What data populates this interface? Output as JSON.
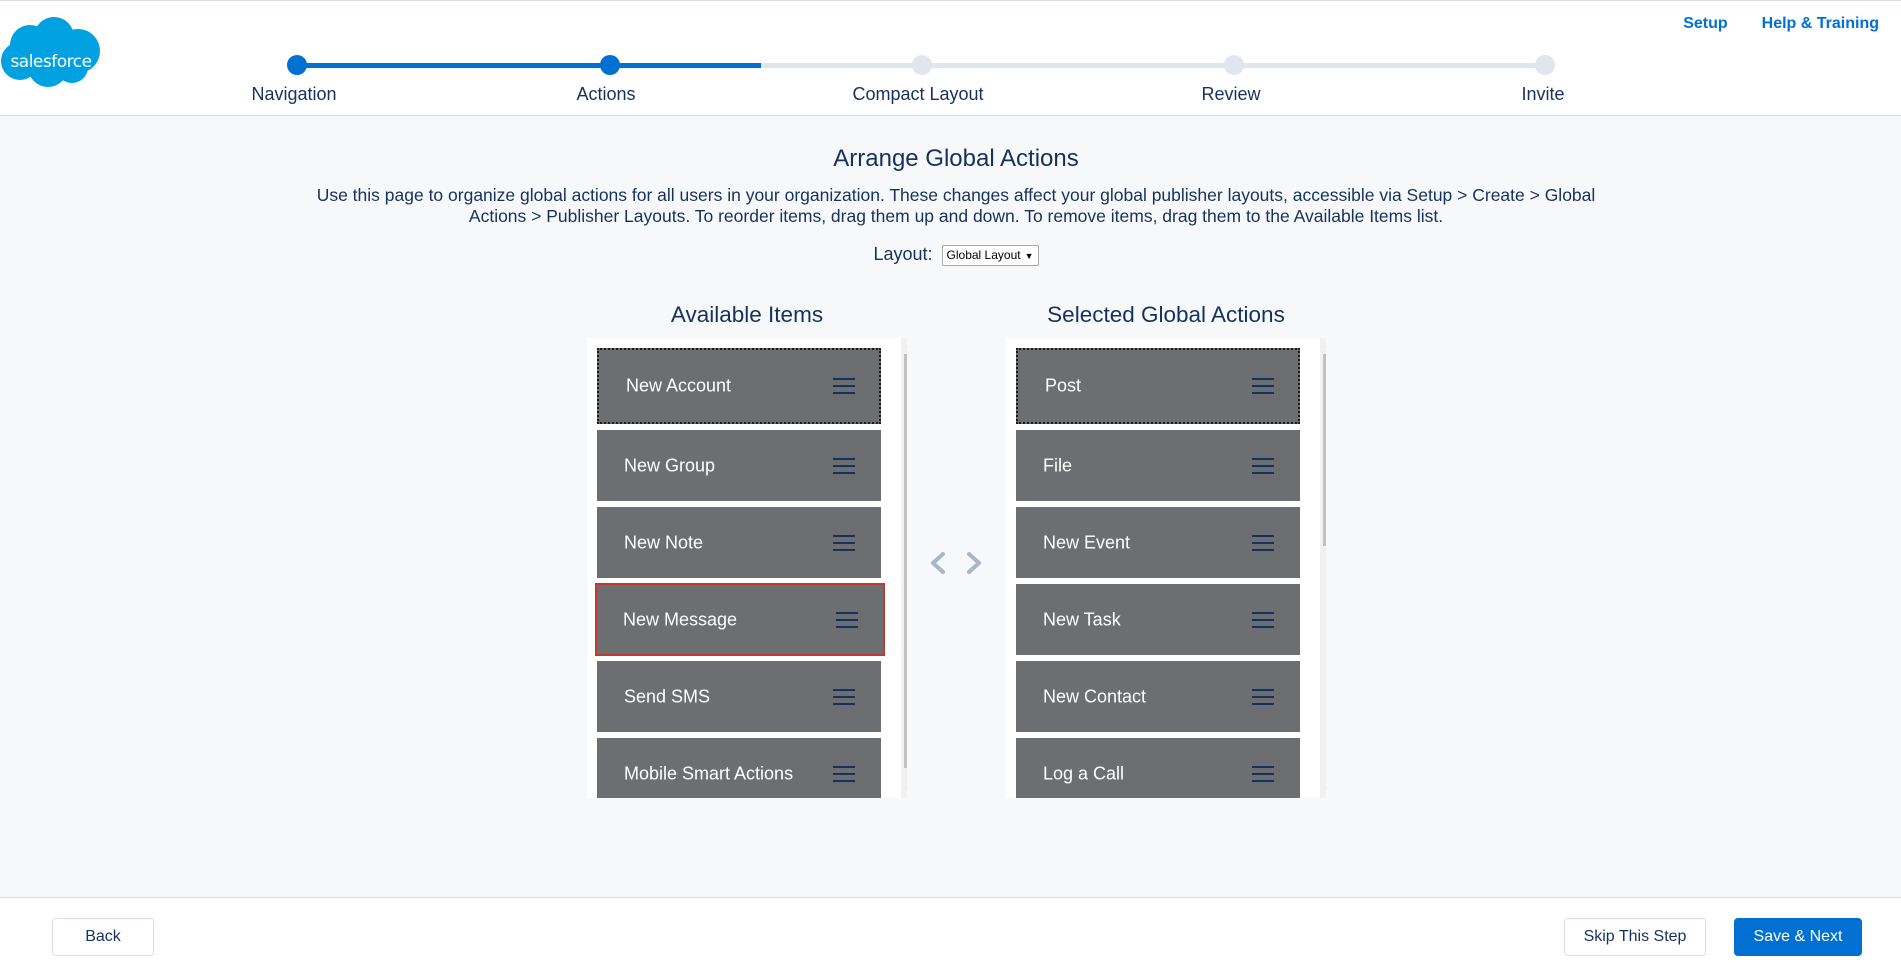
{
  "header": {
    "logo_text": "salesforce",
    "links": {
      "setup": "Setup",
      "help": "Help & Training"
    }
  },
  "progress": {
    "steps": [
      "Navigation",
      "Actions",
      "Compact Layout",
      "Review",
      "Invite"
    ],
    "current_step": 2
  },
  "main": {
    "title": "Arrange Global Actions",
    "description": "Use this page to organize global actions for all users in your organization. These changes affect your global publisher layouts, accessible via Setup > Create > Global Actions > Publisher Layouts. To reorder items, drag them up and down. To remove items, drag them to the Available Items list.",
    "layout_label": "Layout:",
    "layout_value": "Global Layout"
  },
  "available": {
    "title": "Available Items",
    "items": [
      "New Account",
      "New Group",
      "New Note",
      "New Message",
      "Send SMS",
      "Mobile Smart Actions"
    ],
    "highlighted_item": "New Message"
  },
  "selected": {
    "title": "Selected Global Actions",
    "items": [
      "Post",
      "File",
      "New Event",
      "New Task",
      "New Contact",
      "Log a Call"
    ]
  },
  "footer": {
    "back": "Back",
    "skip": "Skip This Step",
    "save_next": "Save & Next"
  },
  "colors": {
    "brand": "#0070d2",
    "item_bg": "#6d6e71",
    "highlight": "#c23934",
    "text": "#16325c"
  }
}
